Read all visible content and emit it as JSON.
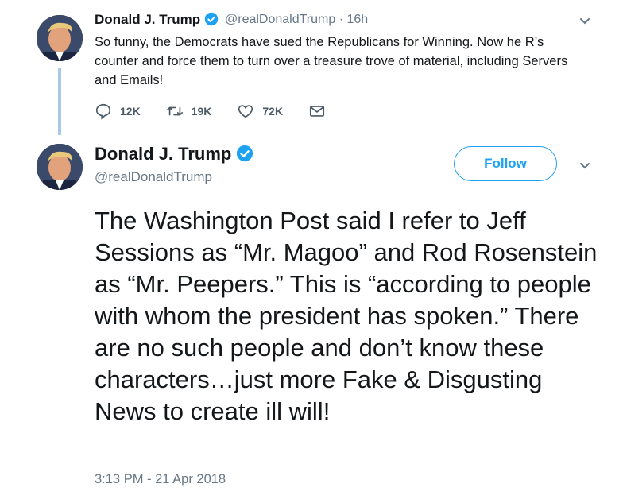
{
  "tweet1": {
    "name": "Donald J. Trump",
    "handle": "@realDonaldTrump",
    "time": "· 16h",
    "text": "So funny, the Democrats have sued the Republicans for Winning. Now he R’s counter and force them to turn over a treasure trove of material, including Servers and Emails!",
    "replies": "12K",
    "retweets": "19K",
    "likes": "72K"
  },
  "tweet2": {
    "name": "Donald J. Trump",
    "handle": "@realDonaldTrump",
    "follow_label": "Follow",
    "text": "The Washington Post said I refer to Jeff Sessions as “Mr. Magoo” and Rod Rosenstein as “Mr. Peepers.” This is “according to people with whom the president has spoken.” There are no such people and don’t know these characters…just more Fake & Disgusting News to create ill will!",
    "timestamp": "3:13 PM - 21 Apr 2018"
  },
  "icons": {
    "verified": "verified-badge-icon",
    "more": "chevron-down-icon",
    "reply": "reply-icon",
    "retweet": "retweet-icon",
    "like": "heart-icon",
    "dm": "envelope-icon"
  },
  "colors": {
    "accent": "#1da1f2",
    "muted": "#657786",
    "thread": "#a9c9e6"
  }
}
